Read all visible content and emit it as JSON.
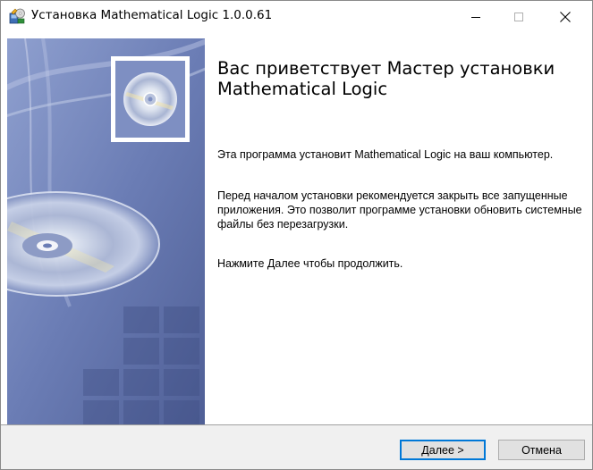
{
  "window": {
    "title": "Установка Mathematical Logic 1.0.0.61",
    "icons": {
      "app": "installer-icon",
      "minimize": "minimize-icon",
      "maximize": "maximize-icon",
      "close": "close-icon"
    }
  },
  "content": {
    "heading": "Вас приветствует Мастер установки Mathematical Logic",
    "paragraph_1": "Эта программа установит Mathematical Logic на ваш компьютер.",
    "paragraph_2": "Перед началом установки рекомендуется закрыть все запущенные приложения. Это позволит программе установки обновить системные файлы без перезагрузки.",
    "paragraph_3": "Нажмите Далее чтобы продолжить."
  },
  "footer": {
    "next_label": "Далее >",
    "cancel_label": "Отмена"
  },
  "colors": {
    "accent": "#0078d7",
    "banner_base": "#6b7fb4",
    "footer_bg": "#f0f0f0"
  }
}
